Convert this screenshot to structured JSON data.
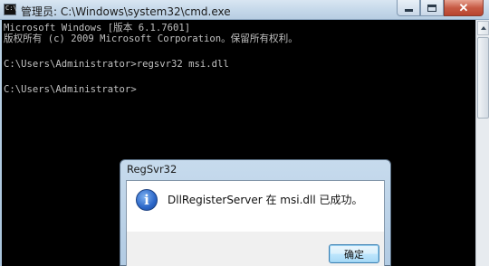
{
  "window": {
    "title": "管理员: C:\\Windows\\system32\\cmd.exe",
    "icon": "cmd-icon"
  },
  "console": {
    "lines": [
      "Microsoft Windows [版本 6.1.7601]",
      "版权所有 (c) 2009 Microsoft Corporation。保留所有权利。",
      "",
      "C:\\Users\\Administrator>regsvr32 msi.dll",
      "",
      "C:\\Users\\Administrator>"
    ]
  },
  "dialog": {
    "title": "RegSvr32",
    "icon": "info-icon",
    "message": "DllRegisterServer 在 msi.dll 已成功。",
    "ok_label": "确定"
  },
  "colors": {
    "console_bg": "#000000",
    "console_text": "#c0c0c0",
    "close_button": "#c75b45"
  }
}
